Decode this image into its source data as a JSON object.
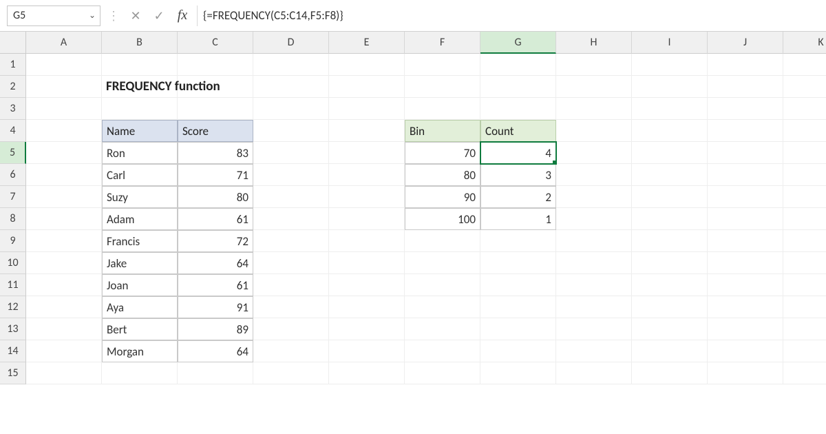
{
  "namebox": "G5",
  "formula": "{=FREQUENCY(C5:C14,F5:F8)}",
  "columns": [
    "A",
    "B",
    "C",
    "D",
    "E",
    "F",
    "G",
    "H",
    "I",
    "J",
    "K"
  ],
  "rows": [
    "1",
    "2",
    "3",
    "4",
    "5",
    "6",
    "7",
    "8",
    "9",
    "10",
    "11",
    "12",
    "13",
    "14",
    "15"
  ],
  "activeCol": "G",
  "activeRow": "5",
  "title": "FREQUENCY function",
  "table1": {
    "headers": {
      "name": "Name",
      "score": "Score"
    },
    "rows": [
      {
        "name": "Ron",
        "score": "83"
      },
      {
        "name": "Carl",
        "score": "71"
      },
      {
        "name": "Suzy",
        "score": "80"
      },
      {
        "name": "Adam",
        "score": "61"
      },
      {
        "name": "Francis",
        "score": "72"
      },
      {
        "name": "Jake",
        "score": "64"
      },
      {
        "name": "Joan",
        "score": "61"
      },
      {
        "name": "Aya",
        "score": "91"
      },
      {
        "name": "Bert",
        "score": "89"
      },
      {
        "name": "Morgan",
        "score": "64"
      }
    ]
  },
  "table2": {
    "headers": {
      "bin": "Bin",
      "count": "Count"
    },
    "rows": [
      {
        "bin": "70",
        "count": "4"
      },
      {
        "bin": "80",
        "count": "3"
      },
      {
        "bin": "90",
        "count": "2"
      },
      {
        "bin": "100",
        "count": "1"
      }
    ]
  }
}
